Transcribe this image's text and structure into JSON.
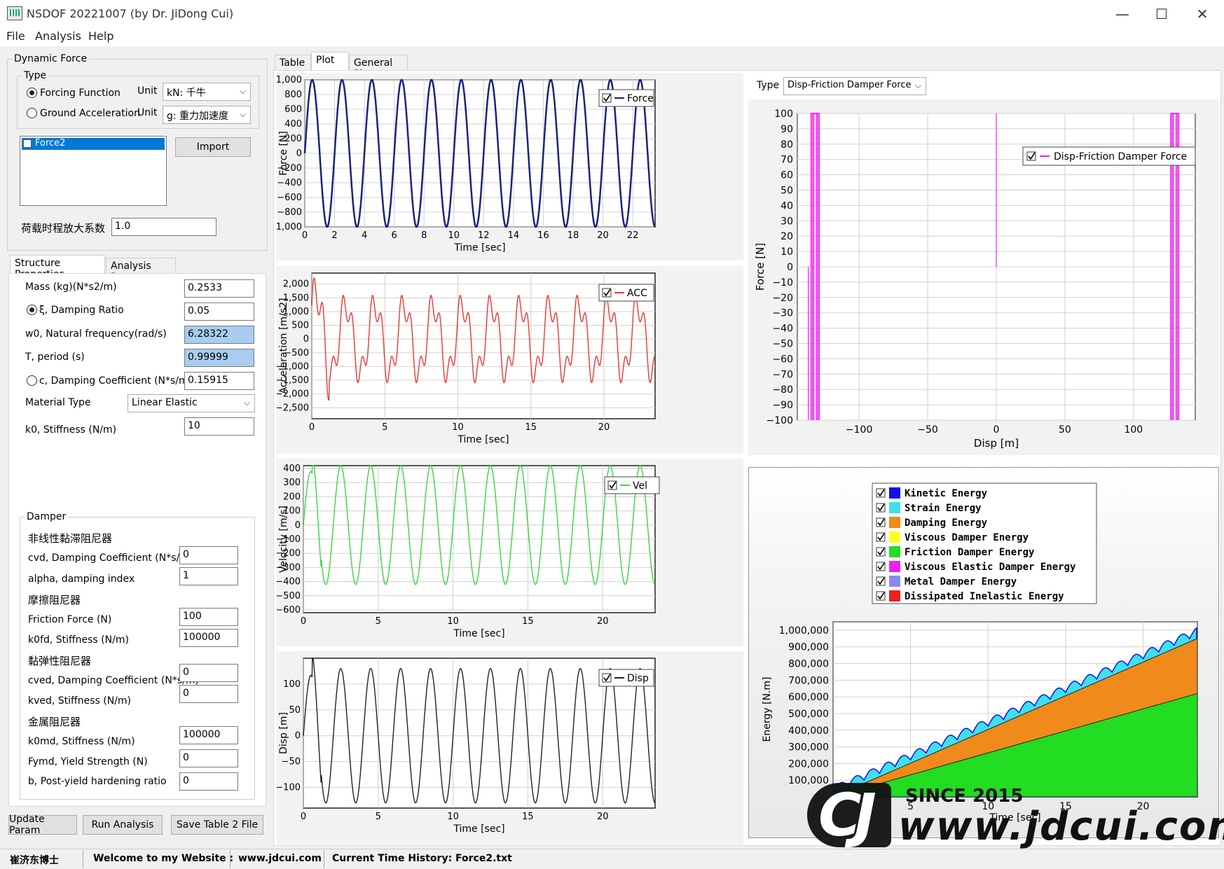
{
  "window": {
    "title": "NSDOF 20221007 (by Dr. JiDong Cui)",
    "minimize": "—",
    "maximize": "☐",
    "close": "✕"
  },
  "menu": [
    "File",
    "Analysis",
    "Help"
  ],
  "dynamic_force": {
    "legend": "Dynamic Force",
    "type_legend": "Type",
    "forcing_function": "Forcing Function",
    "ground_acceleration": "Ground Acceleration",
    "unit_label": "Unit",
    "unit1": "kN: 千牛",
    "unit2": "g: 重力加速度",
    "list_items": [
      "Force2"
    ],
    "import": "Import",
    "amp_label": "荷载时程放大系数",
    "amp_value": "1.0"
  },
  "tabs_left": [
    "Structure Properties",
    "Analysis Param"
  ],
  "structure": {
    "mass_label": "Mass (kg)(N*s2/m)",
    "mass": "0.2533",
    "xi_label": "ξ, Damping Ratio",
    "xi": "0.05",
    "w0_label": "w0, Natural frequency(rad/s)",
    "w0": "6.28322",
    "T_label": "T, period (s)",
    "T": "0.99999",
    "c_label": "c, Damping Coefficient (N*s/m)",
    "c": "0.15915",
    "mat_label": "Material Type",
    "mat": "Linear Elastic",
    "k0_label": "k0, Stiffness (N/m)",
    "k0": "10"
  },
  "damper": {
    "legend": "Damper",
    "nl_title": "非线性黏滞阻尼器",
    "cvd_label": "cvd, Damping Coefficient (N*s/m)",
    "cvd": "0",
    "alpha_label": "alpha, damping index",
    "alpha": "1",
    "fr_title": "摩擦阻尼器",
    "ff_label": "Friction Force (N)",
    "ff": "100",
    "k0fd_label": "k0fd, Stiffness (N/m)",
    "k0fd": "100000",
    "ve_title": "黏弹性阻尼器",
    "cved_label": "cved, Damping Coefficient (N*s/m)",
    "cved": "0",
    "kved_label": "kved, Stiffness (N/m)",
    "kved": "0",
    "m_title": "金属阻尼器",
    "k0md_label": "k0md, Stiffness (N/m)",
    "k0md": "100000",
    "fymd_label": "Fymd, Yield Strength (N)",
    "fymd": "0",
    "b_label": "b, Post-yield hardening ratio",
    "b": "0"
  },
  "buttons": {
    "update": "Update Param",
    "run": "Run Analysis",
    "save": "Save Table 2 File"
  },
  "tabs_main": [
    "Table",
    "Plot",
    "General Plot"
  ],
  "type_selector": {
    "label": "Type",
    "value": "Disp-Friction Damper Force"
  },
  "status": {
    "s1": "崔济东博士",
    "s2": "Welcome to my Website :",
    "s3": "www.jdcui.com",
    "s4": "Current Time History: Force2.txt"
  },
  "watermark": {
    "since": "SINCE 2015",
    "url": "www.jdcui.com",
    "logo": "CJ"
  },
  "chart_data": [
    {
      "id": "force",
      "type": "line",
      "xlabel": "Time [sec]",
      "ylabel": "Force [N]",
      "xlim": [
        0,
        23.5
      ],
      "ylim": [
        -1000,
        1000
      ],
      "xticks": [
        0,
        2,
        4,
        6,
        8,
        10,
        12,
        14,
        16,
        18,
        20,
        22
      ],
      "yticks": [
        -1000,
        -800,
        -600,
        -400,
        -200,
        0,
        200,
        400,
        600,
        800,
        1000
      ],
      "ytick_labels": [
        "−1,000",
        "−800",
        "−600",
        "−400",
        "−200",
        "0",
        "200",
        "400",
        "600",
        "800",
        "1,000"
      ],
      "series": [
        {
          "name": "Force",
          "color": "#1a237e",
          "amplitude": 1000,
          "period": 2.0,
          "phase": 0
        }
      ]
    },
    {
      "id": "acc",
      "type": "line",
      "xlabel": "Time [sec]",
      "ylabel": "Acceleration [m/s2]",
      "xlim": [
        0,
        23.5
      ],
      "ylim": [
        -2900,
        2400
      ],
      "xticks": [
        0,
        5,
        10,
        15,
        20
      ],
      "yticks": [
        -2500,
        -2000,
        -1500,
        -1000,
        -500,
        0,
        500,
        1000,
        1500,
        2000
      ],
      "ytick_labels": [
        "−2,500",
        "−2,000",
        "−1,500",
        "−1,000",
        "−500",
        "0",
        "500",
        "1,000",
        "1,500",
        "2,000"
      ],
      "series": [
        {
          "name": "ACC",
          "color": "#e53935",
          "amplitude": 1600,
          "period": 2.0,
          "phase": 0.5
        }
      ]
    },
    {
      "id": "vel",
      "type": "line",
      "xlabel": "Time [sec]",
      "ylabel": "Velocity [m/s]",
      "xlim": [
        0,
        23.5
      ],
      "ylim": [
        -620,
        420
      ],
      "xticks": [
        0,
        5,
        10,
        15,
        20
      ],
      "yticks": [
        -600,
        -500,
        -400,
        -300,
        -200,
        -100,
        0,
        100,
        200,
        300,
        400
      ],
      "ytick_labels": [
        "−600",
        "−500",
        "−400",
        "−300",
        "−200",
        "−100",
        "0",
        "100",
        "200",
        "300",
        "400"
      ],
      "series": [
        {
          "name": "Vel",
          "color": "#3ad63a",
          "amplitude": 420,
          "period": 2.0,
          "phase": 0
        }
      ]
    },
    {
      "id": "disp",
      "type": "line",
      "xlabel": "Time [sec]",
      "ylabel": "Disp [m]",
      "xlim": [
        0,
        23.5
      ],
      "ylim": [
        -140,
        150
      ],
      "xticks": [
        0,
        5,
        10,
        15,
        20
      ],
      "yticks": [
        -100,
        -50,
        0,
        50,
        100
      ],
      "ytick_labels": [
        "−100",
        "−50",
        "0",
        "50",
        "100"
      ],
      "series": [
        {
          "name": "Disp",
          "color": "#222222",
          "amplitude": 130,
          "period": 2.0,
          "phase": 0
        }
      ]
    },
    {
      "id": "hyst",
      "type": "line",
      "xlabel": "Disp [m]",
      "ylabel": "Force [N]",
      "xlim": [
        -145,
        145
      ],
      "ylim": [
        -100,
        100
      ],
      "xticks": [
        -100,
        -50,
        0,
        50,
        100
      ],
      "yticks": [
        -100,
        -90,
        -80,
        -70,
        -60,
        -50,
        -40,
        -30,
        -20,
        -10,
        0,
        10,
        20,
        30,
        40,
        50,
        60,
        70,
        80,
        90,
        100
      ],
      "xtick_labels": [
        "−100",
        "−50",
        "0",
        "50",
        "100"
      ],
      "ytick_labels": [
        "−100",
        "−90",
        "−80",
        "−70",
        "−60",
        "−50",
        "−40",
        "−30",
        "−20",
        "−10",
        "0",
        "10",
        "20",
        "30",
        "40",
        "50",
        "60",
        "70",
        "80",
        "90",
        "100"
      ],
      "series": [
        {
          "name": "Disp-Friction Damper Force",
          "color": "#ee22ee"
        }
      ]
    },
    {
      "id": "energy",
      "type": "area",
      "xlabel": "Time [sec]",
      "ylabel": "Energy [N.m]",
      "xlim": [
        0,
        23.5
      ],
      "ylim": [
        0,
        1050000
      ],
      "xticks": [
        5,
        10,
        15,
        20
      ],
      "yticks": [
        100000,
        200000,
        300000,
        400000,
        500000,
        600000,
        700000,
        800000,
        900000,
        1000000
      ],
      "ytick_labels": [
        "100,000",
        "200,000",
        "300,000",
        "400,000",
        "500,000",
        "600,000",
        "700,000",
        "800,000",
        "900,000",
        "1,000,000"
      ],
      "series": [
        {
          "name": "Kinetic Energy",
          "color": "#1010ee"
        },
        {
          "name": "Strain Energy",
          "color": "#3ee0ee"
        },
        {
          "name": "Damping Energy",
          "color": "#f08a1a"
        },
        {
          "name": "Viscous Damper Energy",
          "color": "#ffff20"
        },
        {
          "name": "Friction Damper Energy",
          "color": "#22dd22"
        },
        {
          "name": "Viscous Elastic Damper Energy",
          "color": "#ee22ee"
        },
        {
          "name": "Metal Damper Energy",
          "color": "#8a8aee"
        },
        {
          "name": "Dissipated Inelastic Energy",
          "color": "#ee2020"
        }
      ],
      "friction_end": 620000,
      "damping_end": 950000,
      "total_end": 1030000
    }
  ]
}
